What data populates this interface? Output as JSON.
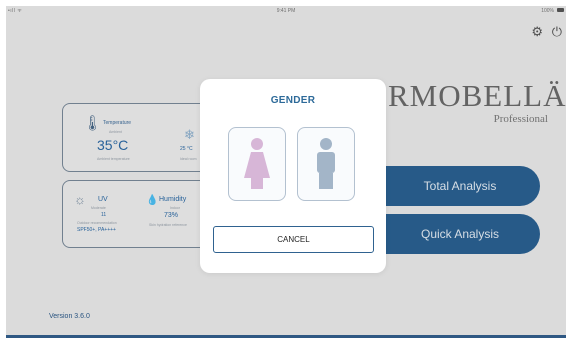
{
  "status_bar": {
    "signal": "•ıll ᯤ",
    "time": "9:41 PM",
    "battery": "100%"
  },
  "top_icons": {
    "settings": "gear-icon",
    "power": "power-icon"
  },
  "brand": {
    "wordmark": "RMOBELLÄ",
    "sub": "Professional"
  },
  "temperature_card": {
    "title": "Temperature",
    "subtitle": "Ambient",
    "value": "35°C",
    "caption": "Ambient temperature",
    "side_value": "25 °C",
    "side_caption": "Ideal room"
  },
  "uv_card": {
    "uv_title": "UV",
    "uv_sub": "Moderate",
    "uv_value": "11",
    "uv_caption": "Outdoor recommendation",
    "uv_spf": "SPF50+, PA++++",
    "humidity_title": "Humidity",
    "humidity_sub": "Indoor",
    "humidity_value": "73%",
    "humidity_caption": "Skin hydration reference"
  },
  "actions": {
    "total": "Total Analysis",
    "quick": "Quick Analysis"
  },
  "version": "Version 3.6.0",
  "modal": {
    "title": "GENDER",
    "cancel": "CANCEL"
  },
  "colors": {
    "primary": "#2a6193",
    "female": "#d7b6d7",
    "male": "#a3b5c8"
  }
}
